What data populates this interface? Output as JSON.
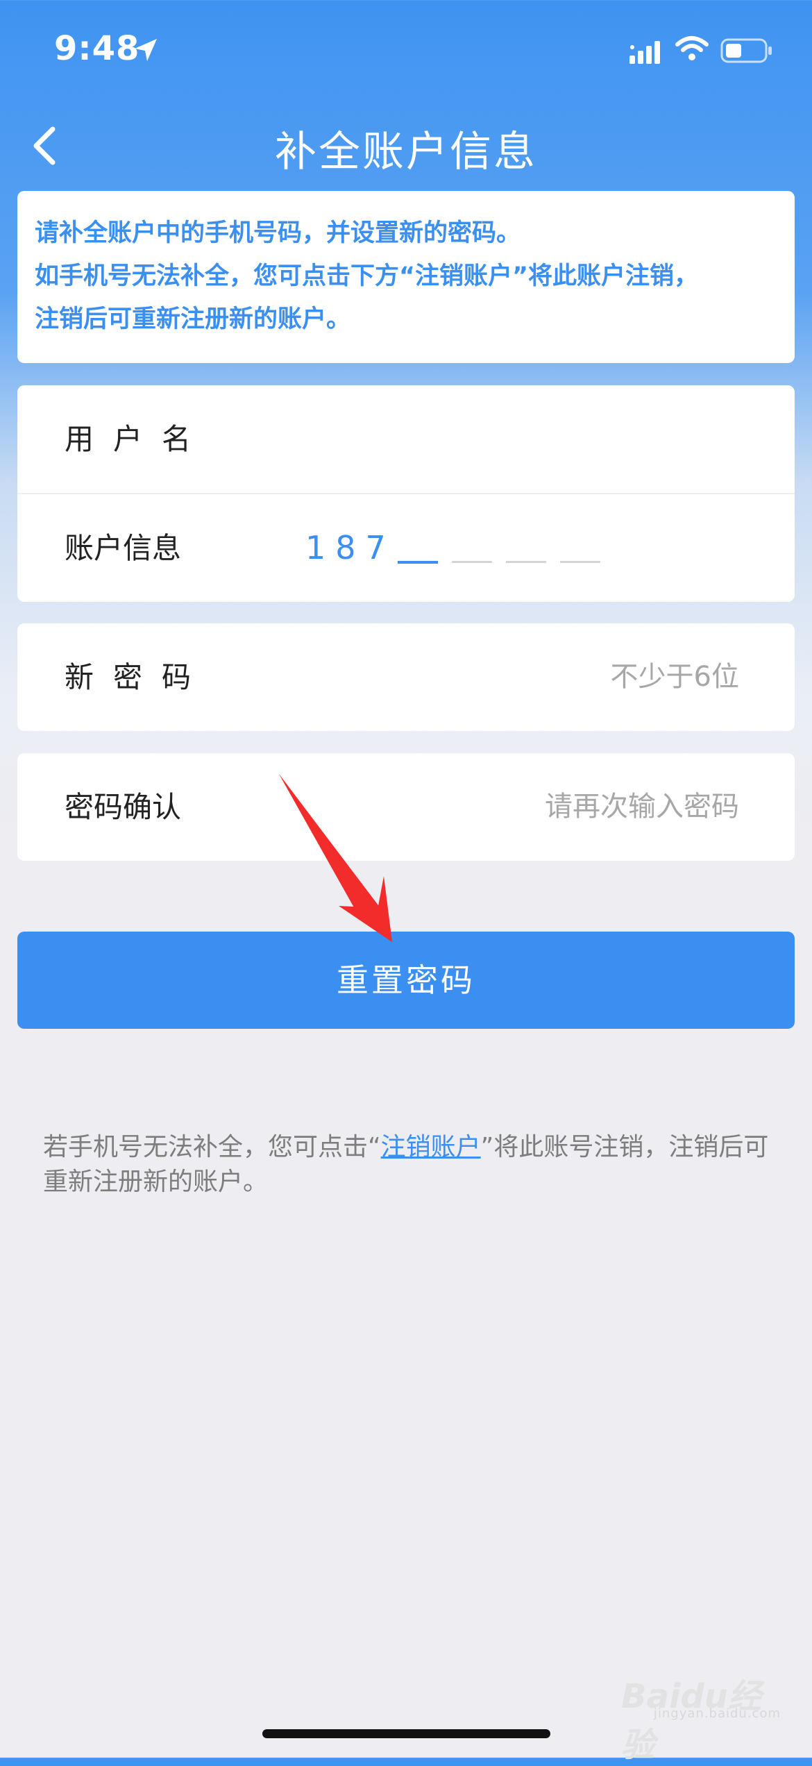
{
  "status_bar": {
    "time": "9:48"
  },
  "nav": {
    "title": "补全账户信息"
  },
  "notice": {
    "line1": "请补全账户中的手机号码，并设置新的密码。",
    "line2": "如手机号无法补全，您可点击下方“注销账户”将此账户注销，",
    "line3": "注销后可重新注册新的账户。"
  },
  "form": {
    "username_label": "用户名",
    "account_label": "账户信息",
    "account_prefix": "187",
    "new_password_label": "新密码",
    "new_password_placeholder": "不少于6位",
    "confirm_label": "密码确认",
    "confirm_placeholder": "请再次输入密码"
  },
  "reset_button": {
    "label": "重置密码"
  },
  "footer": {
    "before": "若手机号无法补全，您可点击“",
    "link": "注销账户",
    "after": "”将此账号注销，注销后可重新注册新的账户。"
  },
  "watermark": {
    "logo": "Baidu经验",
    "site": "jingyan.baidu.com"
  },
  "colors": {
    "accent": "#3a8ff0",
    "annotation_arrow": "#f22b2b"
  },
  "icons": {
    "back": "chevron-left-icon",
    "location": "location-arrow-icon",
    "signal": "cellular-signal-icon",
    "wifi": "wifi-icon",
    "battery": "battery-icon"
  }
}
